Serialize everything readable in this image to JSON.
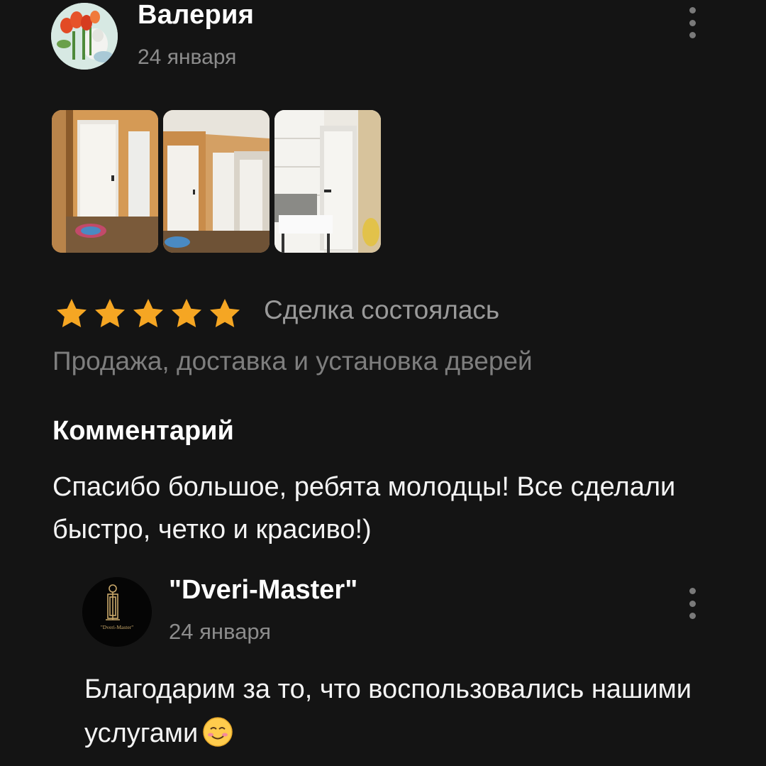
{
  "review": {
    "author_name": "Валерия",
    "date": "24 января",
    "photos": [
      {
        "icon": "door-photo"
      },
      {
        "icon": "door-photo"
      },
      {
        "icon": "door-photo"
      }
    ],
    "rating": 5,
    "rating_max": 5,
    "status": "Сделка состоялась",
    "service": "Продажа, доставка и установка дверей",
    "comment_heading": "Комментарий",
    "comment_text": "Спасибо большое, ребята молодцы! Все сделали быстро, четко и красиво!)"
  },
  "reply": {
    "author_name": "\"Dveri-Master\"",
    "avatar_caption": "\"Dveri-Master\"",
    "date": "24 января",
    "text": "Благодарим за то, что воспользовались нашими услугами",
    "emoji": "smiling-face-icon"
  },
  "colors": {
    "background": "#141414",
    "star": "#f5a623",
    "muted_text": "#8c8c8c"
  }
}
